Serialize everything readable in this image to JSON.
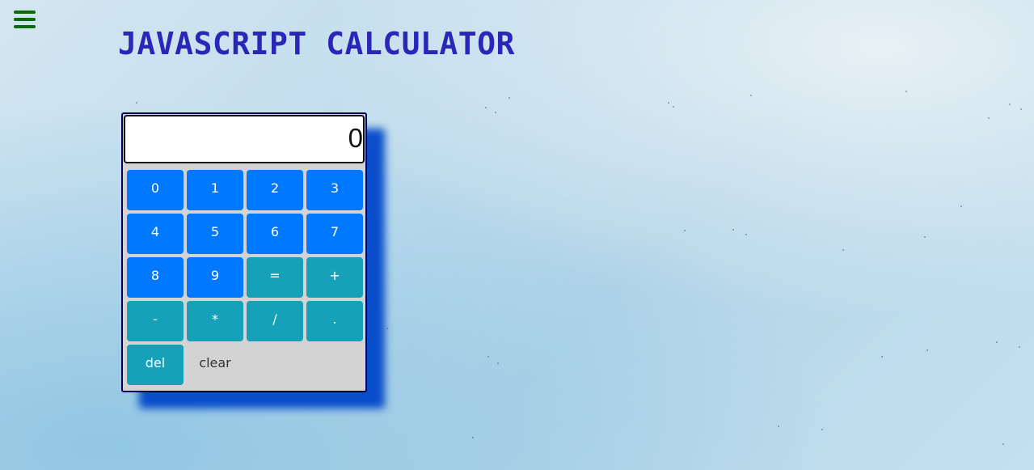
{
  "page": {
    "title": "JAVASCRIPT CALCULATOR"
  },
  "calculator": {
    "display": "0",
    "digit_keys": [
      "0",
      "1",
      "2",
      "3",
      "4",
      "5",
      "6",
      "7",
      "8",
      "9"
    ],
    "operator_keys": [
      "=",
      "+",
      "-",
      "*",
      "/",
      "."
    ],
    "delete_label": "del",
    "clear_label": "clear"
  },
  "icons": {
    "menu": "hamburger-menu-icon"
  },
  "colors": {
    "title": "#2a27b8",
    "menu_icon": "#086c08",
    "digit_key": "#0078ff",
    "operator_key": "#17a1b8",
    "calculator_body": "#d3d3d3",
    "calculator_border": "#00005a",
    "shadow": "#0046c8"
  }
}
